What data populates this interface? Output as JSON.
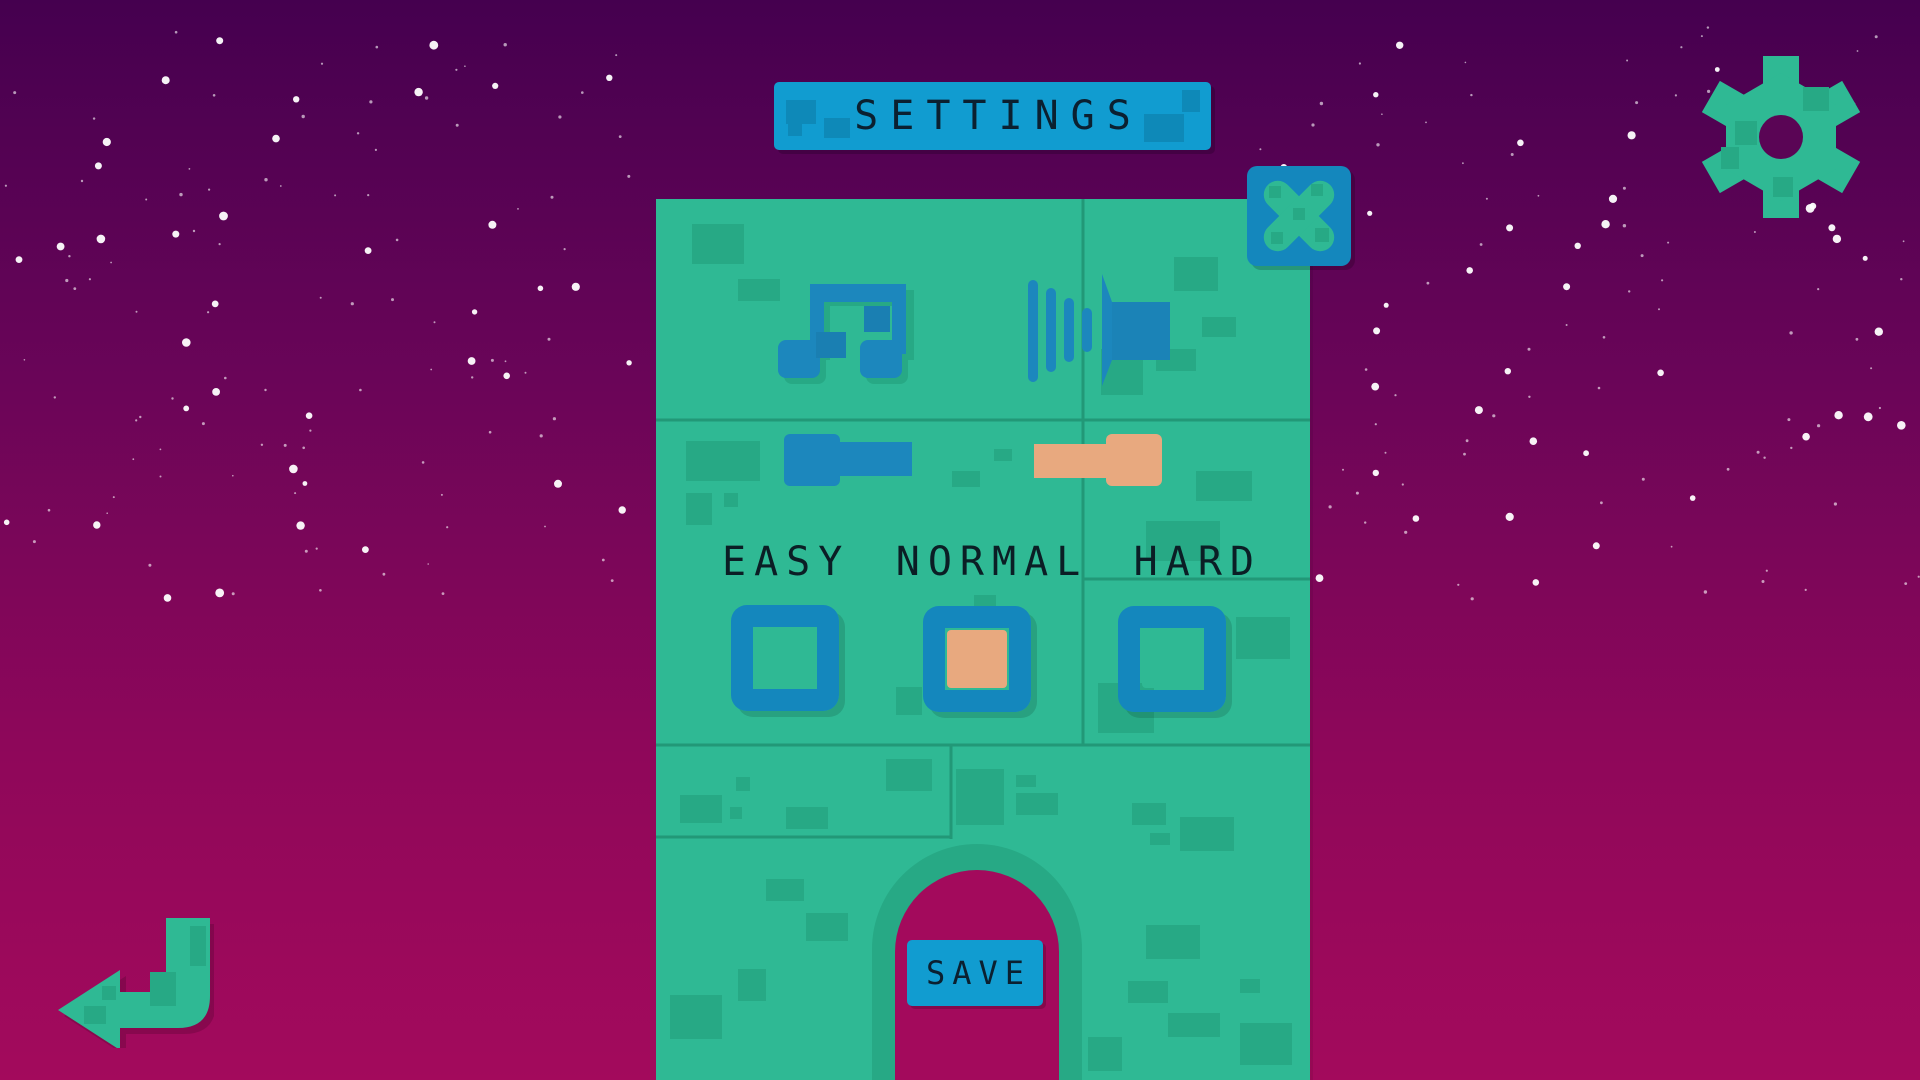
{
  "screen": {
    "title": "SETTINGS",
    "background_gradient": [
      "#45004f",
      "#a30a5c"
    ]
  },
  "colors": {
    "panel_green": "#2fb994",
    "accent_blue": "#1487bd",
    "banner_blue": "#119cd0",
    "accent_peach": "#e8a97f",
    "text_dark": "#0b1e25"
  },
  "header": {
    "settings_icon": "gear-icon",
    "close_icon": "close-x-icon"
  },
  "audio": {
    "music": {
      "icon": "music-note-icon",
      "level": 0.0
    },
    "sound_effects": {
      "icon": "speaker-icon",
      "level": 1.0
    }
  },
  "difficulty": {
    "options": [
      {
        "label": "EASY",
        "selected": false
      },
      {
        "label": "NORMAL",
        "selected": true
      },
      {
        "label": "HARD",
        "selected": false
      }
    ]
  },
  "footer": {
    "save_label": "SAVE",
    "back_icon": "back-arrow-icon"
  }
}
